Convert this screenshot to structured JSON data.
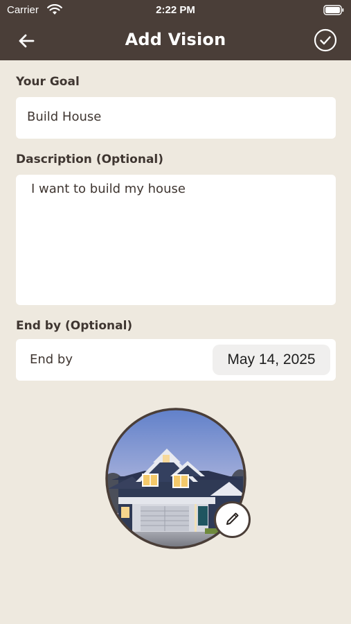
{
  "status_bar": {
    "carrier": "Carrier",
    "time": "2:22 PM",
    "icons": [
      "wifi-icon",
      "battery-icon"
    ]
  },
  "nav": {
    "title": "Add Vision",
    "back_icon": "arrow-left-icon",
    "done_icon": "check-circle-icon"
  },
  "form": {
    "goal": {
      "label": "Your Goal",
      "value": "Build House"
    },
    "description": {
      "label": "Dascription (Optional)",
      "value": "I want to build my house"
    },
    "end_by": {
      "label": "End by (Optional)",
      "row_label": "End by",
      "date_value": "May 14, 2025"
    }
  },
  "photo": {
    "edit_icon": "pencil-icon"
  },
  "colors": {
    "header": "#4A3E38",
    "background": "#EEE9DF",
    "text": "#3F3631",
    "field": "#FFFFFF"
  }
}
